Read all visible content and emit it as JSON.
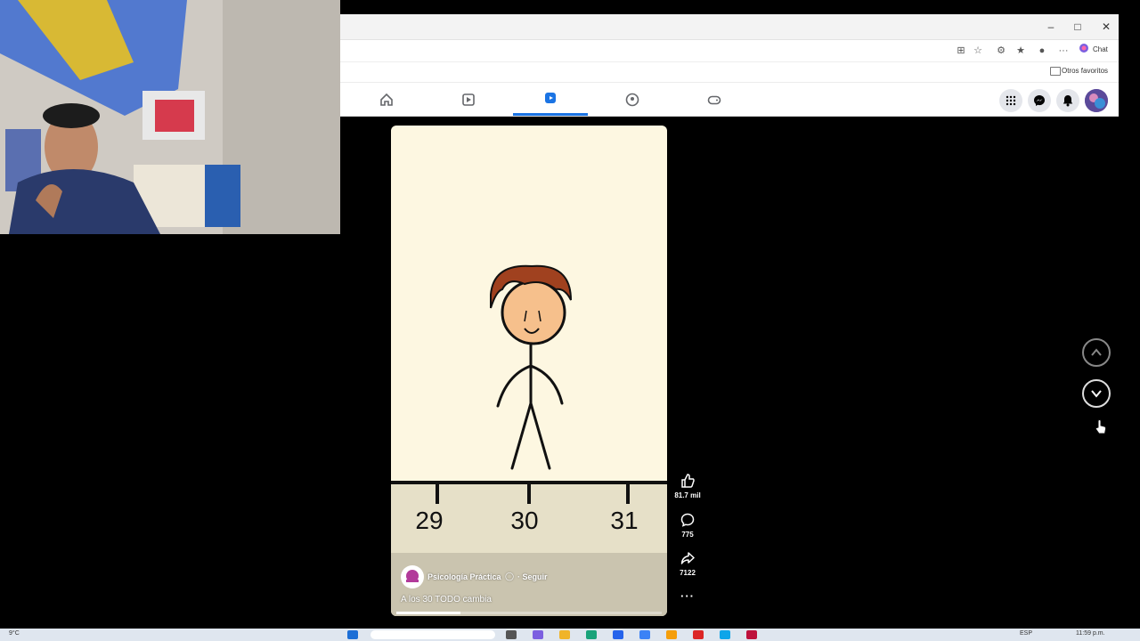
{
  "browser": {
    "favorites_label": "Otros favoritos",
    "chat_label": "Chat",
    "window_controls": [
      "minimize",
      "maximize",
      "close"
    ]
  },
  "facebook_nav": {
    "tabs": [
      {
        "name": "home-icon",
        "active": false
      },
      {
        "name": "watch-icon",
        "active": false
      },
      {
        "name": "reels-icon",
        "active": true
      },
      {
        "name": "groups-icon",
        "active": false
      },
      {
        "name": "gaming-icon",
        "active": false
      }
    ],
    "right_icons": [
      "menu-grid-icon",
      "messenger-icon",
      "notifications-icon",
      "profile-avatar"
    ]
  },
  "reel": {
    "ruler_labels": [
      "29",
      "30",
      "31"
    ],
    "author": "Psicología Práctica",
    "follow_label": "· Seguir",
    "caption": "A los 30 TODO cambia",
    "progress": 0.24,
    "likes": "81.7 mil",
    "comments": "775",
    "shares": "7122"
  },
  "colors": {
    "accent": "#1b74e4",
    "reel_bg": "#fdf7e1",
    "hair": "#a0411f",
    "skin": "#f6c08c"
  },
  "taskbar": {
    "weather": "9°C",
    "lang": "ESP",
    "time": "11:59 p.m."
  }
}
